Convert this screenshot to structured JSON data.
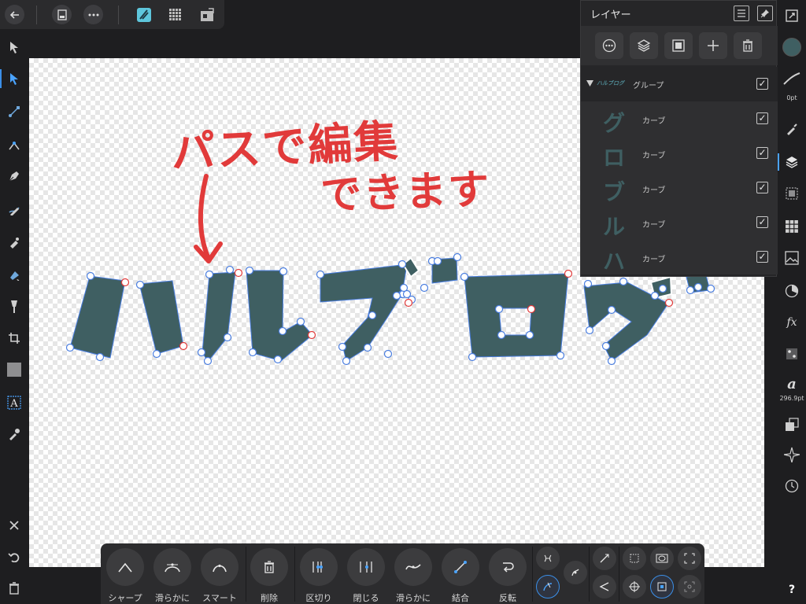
{
  "colors": {
    "accent": "#3b8fe8",
    "fill": "#3f5f62",
    "annotation": "#e13a3a",
    "panel": "#262628"
  },
  "topbar": {
    "icons": [
      "back-arrow-icon",
      "document-icon",
      "more-icon",
      "designer-persona-icon",
      "pixel-persona-icon",
      "export-persona-icon"
    ]
  },
  "annotation": {
    "line1": "パスで編集",
    "line2": "できます"
  },
  "layers_panel": {
    "title": "レイヤー",
    "group": {
      "thumb": "ハルブログ",
      "name": "グループ",
      "checked": true
    },
    "children": [
      {
        "thumb": "グ",
        "name": "カーブ",
        "checked": true
      },
      {
        "thumb": "ロ",
        "name": "カーブ",
        "checked": true
      },
      {
        "thumb": "ブ",
        "name": "カーブ",
        "checked": true
      },
      {
        "thumb": "ル",
        "name": "カーブ",
        "checked": true
      },
      {
        "thumb": "ハ",
        "name": "カーブ",
        "checked": true
      }
    ]
  },
  "right_toolbar": {
    "stroke_width": "0pt",
    "font_size": "296.9pt",
    "help": "?"
  },
  "context_toolbar": {
    "buttons": [
      {
        "label": "シャープ"
      },
      {
        "label": "滑らかに"
      },
      {
        "label": "スマート"
      },
      {
        "label": "削除"
      },
      {
        "label": "区切り"
      },
      {
        "label": "閉じる"
      },
      {
        "label": "滑らかに"
      },
      {
        "label": "結合"
      },
      {
        "label": "反転"
      }
    ]
  }
}
